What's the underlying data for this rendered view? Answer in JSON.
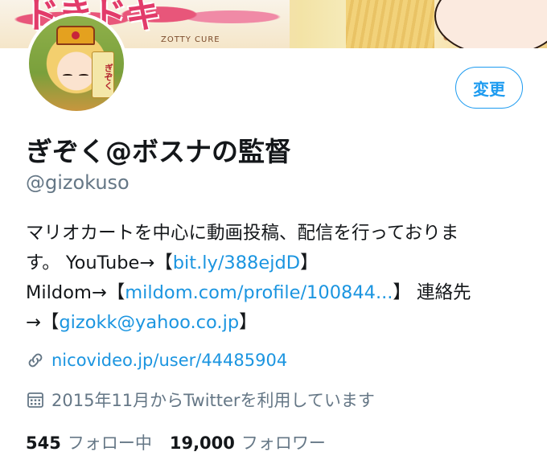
{
  "banner": {
    "wordmark": "ドきドキ",
    "subtitle": "ZOTTY CURE"
  },
  "avatar": {
    "tag_text": "ぎぞく"
  },
  "profile": {
    "edit_label": "変更",
    "display_name": "ぎぞく@ボスナの監督",
    "handle": "@gizokuso"
  },
  "bio": {
    "line1": "マリオカートを中心に動画投稿、配信を行っておりま",
    "line2_text": "す。 YouTube→【",
    "line2_link": "bit.ly/388ejdD",
    "line2_end": "】",
    "line3_text": "Mildom→【",
    "line3_link": "mildom.com/profile/100844...",
    "line3_end": "】 連絡先",
    "line4_text": "→【",
    "line4_link": "gizokk@yahoo.co.jp",
    "line4_end": "】"
  },
  "meta": {
    "website": "nicovideo.jp/user/44485904",
    "joined": "2015年11月からTwitterを利用しています",
    "website_icon": "link-icon",
    "joined_icon": "calendar-icon"
  },
  "stats": {
    "following_count": "545",
    "following_label": "フォロー中",
    "followers_count": "19,000",
    "followers_label": "フォロワー"
  },
  "colors": {
    "accent": "#1b95e0",
    "secondary_text": "#657786"
  }
}
